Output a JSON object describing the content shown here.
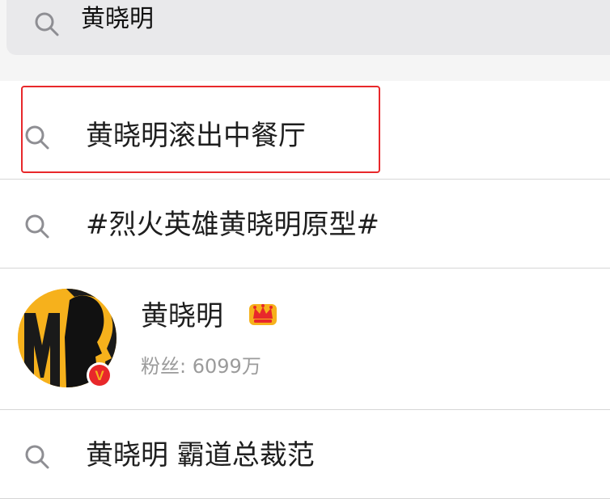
{
  "search": {
    "query": "黄晓明"
  },
  "results": [
    {
      "type": "suggestion",
      "text": "黄晓明滚出中餐厅",
      "icon": "search-icon"
    },
    {
      "type": "suggestion",
      "text": "#烈火英雄黄晓明原型#",
      "icon": "search-icon"
    },
    {
      "type": "user",
      "name": "黄晓明",
      "fans_label": "粉丝:",
      "fans_value": "6099万",
      "badge": "V",
      "avatar_icon": "avatar",
      "crown_icon": "crown-icon"
    },
    {
      "type": "suggestion",
      "text": "黄晓明 霸道总裁范",
      "icon": "search-icon"
    }
  ],
  "colors": {
    "highlight": "#e8282b",
    "verified_badge": "#e8282b",
    "crown": "#f6b11c",
    "secondary_text": "#9b9b9b"
  }
}
